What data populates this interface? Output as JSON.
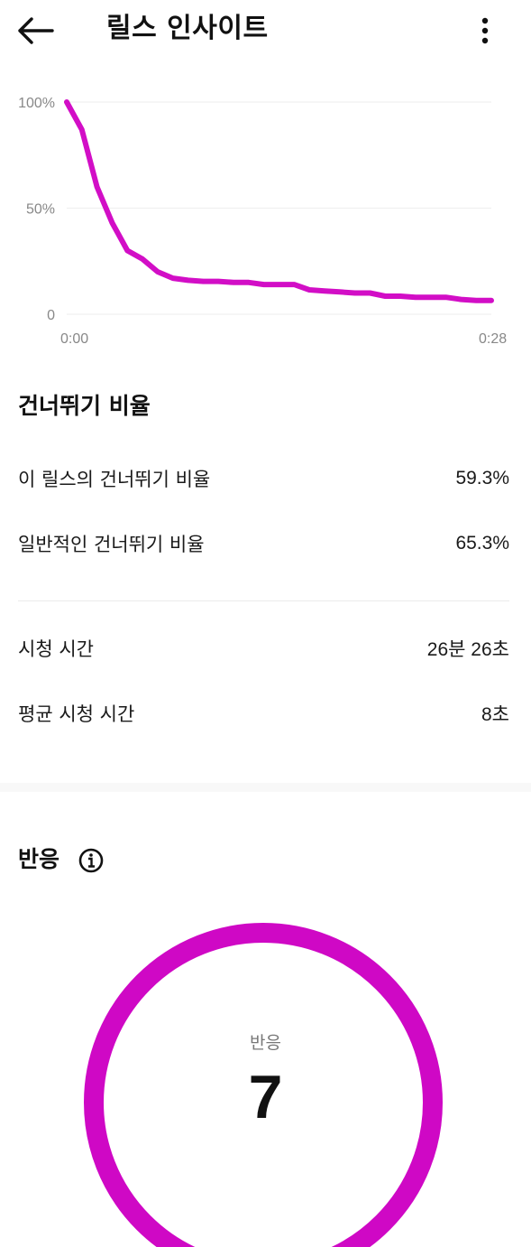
{
  "header": {
    "title": "릴스 인사이트",
    "back_icon": "arrow-left-icon",
    "more_icon": "more-vertical-icon"
  },
  "chart_data": {
    "type": "line",
    "x_ticks": [
      "0:00",
      "0:28"
    ],
    "y_ticks": [
      "100%",
      "50%",
      "0"
    ],
    "ylim": [
      0,
      100
    ],
    "grid": true,
    "color": "#d20ec6",
    "x": [
      0,
      1,
      2,
      3,
      4,
      5,
      6,
      7,
      8,
      9,
      10,
      11,
      12,
      13,
      14,
      15,
      16,
      17,
      18,
      19,
      20,
      21,
      22,
      23,
      24,
      25,
      26,
      27,
      28
    ],
    "values": [
      100,
      87,
      60,
      43,
      30,
      26,
      20,
      17,
      16,
      15.5,
      15.5,
      15,
      15,
      14,
      14,
      14,
      11.5,
      11,
      10.5,
      10,
      10,
      8.5,
      8.5,
      8,
      8,
      8,
      7,
      6.5,
      6.5
    ]
  },
  "skip_rate": {
    "title": "건너뛰기 비율",
    "rows": [
      {
        "label": "이 릴스의 건너뛰기 비율",
        "value": "59.3%"
      },
      {
        "label": "일반적인 건너뛰기 비율",
        "value": "65.3%"
      }
    ]
  },
  "watch_time": {
    "rows": [
      {
        "label": "시청 시간",
        "value": "26분 26초"
      },
      {
        "label": "평균 시청 시간",
        "value": "8초"
      }
    ]
  },
  "reactions": {
    "title": "반응",
    "info_icon": "info-icon",
    "ring_label": "반응",
    "ring_value": "7",
    "ring_color": "#cf08c5"
  }
}
